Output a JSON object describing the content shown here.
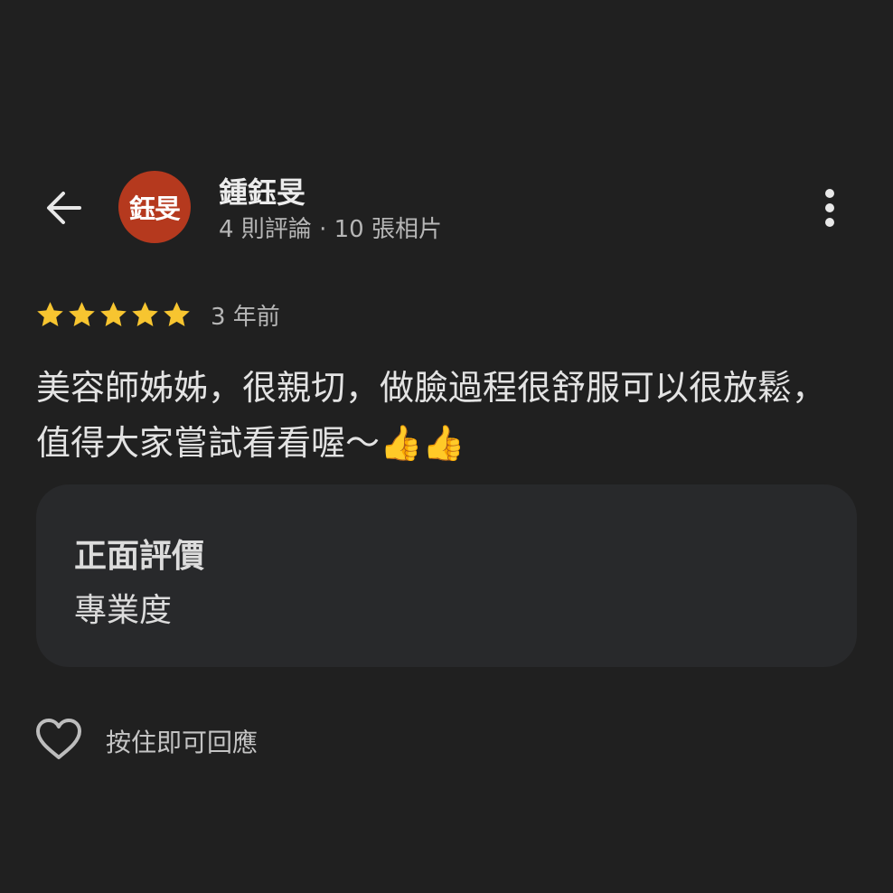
{
  "header": {
    "back_icon": "arrow-left-icon",
    "avatar_text": "鈺旻",
    "avatar_color": "#b5391e",
    "reviewer_name": "鍾鈺旻",
    "reviewer_meta": "4 則評論 · 10 張相片",
    "more_icon": "more-vertical-icon"
  },
  "review": {
    "rating": 5,
    "rating_max": 5,
    "star_color": "#f7c530",
    "time": "3 年前",
    "text": "美容師姊姊，很親切，做臉過程很舒服可以很放鬆，值得大家嘗試看看喔～👍👍"
  },
  "attribute": {
    "title": "正面評價",
    "value": "專業度"
  },
  "footer": {
    "like_icon": "heart-outline-icon",
    "like_hint": "按住即可回應"
  }
}
